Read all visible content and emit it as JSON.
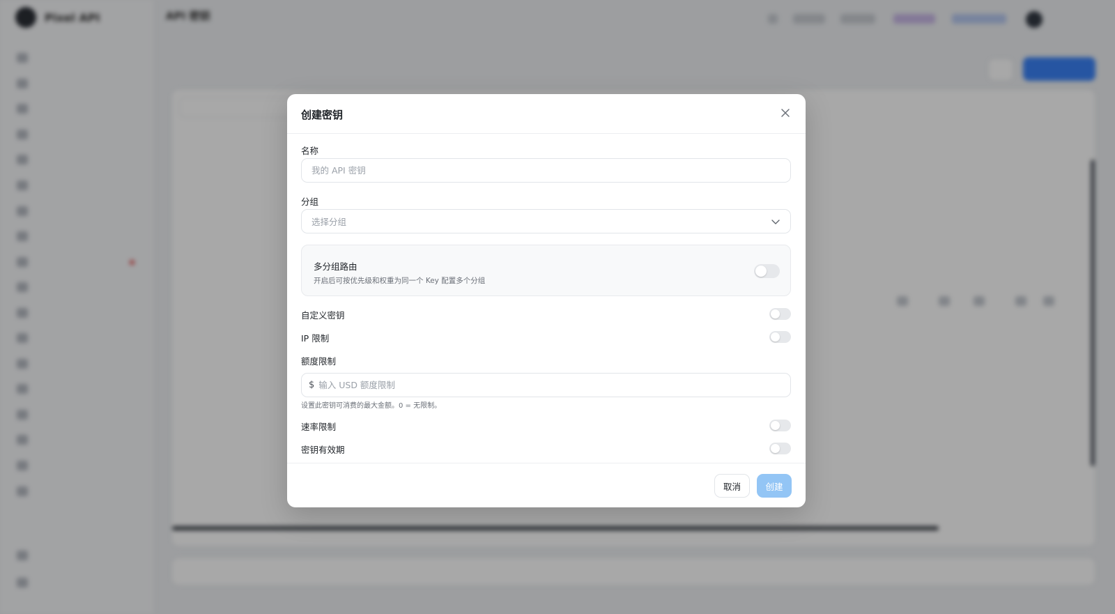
{
  "background": {
    "brand": {
      "name": "Pixel API",
      "sub": ""
    },
    "page_title": "API 密钥",
    "create_label": "",
    "search_placeholder": ""
  },
  "modal": {
    "title": "创建密钥",
    "name_label": "名称",
    "name_placeholder": "我的 API 密钥",
    "group_label": "分组",
    "group_placeholder": "选择分组",
    "multi_route_title": "多分组路由",
    "multi_route_desc": "开启后可按优先级和权重为同一个 Key 配置多个分组",
    "multi_route_enabled": false,
    "custom_key_label": "自定义密钥",
    "custom_key_enabled": false,
    "ip_limit_label": "IP 限制",
    "ip_limit_enabled": false,
    "quota_label": "额度限制",
    "currency_symbol": "$",
    "quota_placeholder": "输入 USD 额度限制",
    "quota_hint": "设置此密钥可消费的最大金额。0 = 无限制。",
    "rate_limit_label": "速率限制",
    "rate_limit_enabled": false,
    "expiry_label": "密钥有效期",
    "expiry_enabled": false,
    "cancel_label": "取消",
    "create_label": "创建",
    "colors": {
      "primary_disabled": "#93c5f5",
      "toggle_off": "#e6e8eb"
    }
  }
}
